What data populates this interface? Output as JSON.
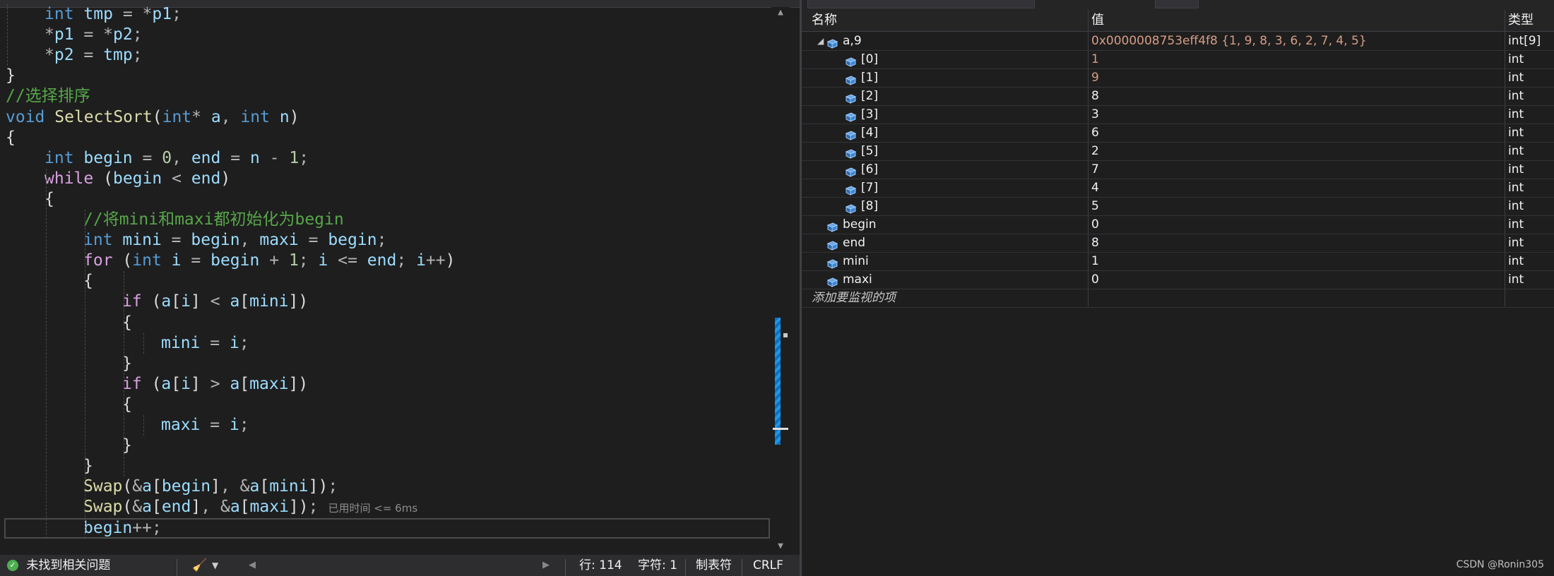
{
  "editor": {
    "code_lines": [
      [
        "int",
        "tmp",
        "=",
        "*",
        "p1",
        ";"
      ],
      [
        "*",
        "p1",
        "=",
        "*",
        "p2",
        ";"
      ],
      [
        "*",
        "p2",
        "=",
        "tmp",
        ";"
      ],
      [
        "}"
      ],
      [
        "//选择排序"
      ],
      [
        "void",
        "SelectSort",
        "(",
        "int",
        "*",
        "a",
        ",",
        "int",
        "n",
        ")"
      ],
      [
        "{"
      ],
      [
        "int",
        "begin",
        "=",
        "0",
        ",",
        "end",
        "=",
        "n",
        "-",
        "1",
        ";"
      ],
      [
        "while",
        "(",
        "begin",
        "<",
        "end",
        ")"
      ],
      [
        "{"
      ],
      [
        "//将mini和maxi都初始化为begin"
      ],
      [
        "int",
        "mini",
        "=",
        "begin",
        ",",
        "maxi",
        "=",
        "begin",
        ";"
      ],
      [
        "for",
        "(",
        "int",
        "i",
        "=",
        "begin",
        "+",
        "1",
        ";",
        "i",
        "<=",
        "end",
        ";",
        "i",
        "++",
        ")"
      ],
      [
        "{"
      ],
      [
        "if",
        "(",
        "a",
        "[",
        "i",
        "]",
        "<",
        "a",
        "[",
        "mini",
        "]",
        ")"
      ],
      [
        "{"
      ],
      [
        "mini",
        "=",
        "i",
        ";"
      ],
      [
        "}"
      ],
      [
        "if",
        "(",
        "a",
        "[",
        "i",
        "]",
        ">",
        "a",
        "[",
        "maxi",
        "]",
        ")"
      ],
      [
        "{"
      ],
      [
        "maxi",
        "=",
        "i",
        ";"
      ],
      [
        "}"
      ],
      [
        "}"
      ],
      [
        "Swap",
        "(",
        "&",
        "a",
        "[",
        "begin",
        "]",
        ",",
        "&",
        "a",
        "[",
        "mini",
        "]",
        ")",
        ";"
      ],
      [
        "Swap",
        "(",
        "&",
        "a",
        "[",
        "end",
        "]",
        ",",
        "&",
        "a",
        "[",
        "maxi",
        "]",
        ")",
        ";"
      ],
      [
        "begin",
        "++",
        ";"
      ]
    ],
    "elapsed_hint": "已用时间 <= 6ms"
  },
  "statusbar": {
    "issues": "未找到相关问题",
    "line": "行: 114",
    "char": "字符: 1",
    "tabs": "制表符",
    "eol": "CRLF"
  },
  "watch": {
    "headers": {
      "name": "名称",
      "value": "值",
      "type": "类型"
    },
    "rows": [
      {
        "name": "a,9",
        "value": "0x0000008753eff4f8 {1, 9, 8, 3, 6, 2, 7, 4, 5}",
        "type": "int[9]",
        "expanded": true
      },
      {
        "name": "[0]",
        "value": "1",
        "type": "int"
      },
      {
        "name": "[1]",
        "value": "9",
        "type": "int"
      },
      {
        "name": "[2]",
        "value": "8",
        "type": "int"
      },
      {
        "name": "[3]",
        "value": "3",
        "type": "int"
      },
      {
        "name": "[4]",
        "value": "6",
        "type": "int"
      },
      {
        "name": "[5]",
        "value": "2",
        "type": "int"
      },
      {
        "name": "[6]",
        "value": "7",
        "type": "int"
      },
      {
        "name": "[7]",
        "value": "4",
        "type": "int"
      },
      {
        "name": "[8]",
        "value": "5",
        "type": "int"
      },
      {
        "name": "begin",
        "value": "0",
        "type": "int"
      },
      {
        "name": "end",
        "value": "8",
        "type": "int"
      },
      {
        "name": "mini",
        "value": "1",
        "type": "int"
      },
      {
        "name": "maxi",
        "value": "0",
        "type": "int"
      }
    ],
    "add_item": "添加要监视的项"
  },
  "watermark": "CSDN @Ronin305",
  "colors": {
    "keyword": "#569cd6",
    "control": "#d8a0df",
    "variable": "#9cdcfe",
    "function": "#dcdcaa",
    "number": "#b5cea8",
    "comment": "#57a64a",
    "changed_value": "#d69d85",
    "scroll_thumb": "#1c97ea"
  }
}
